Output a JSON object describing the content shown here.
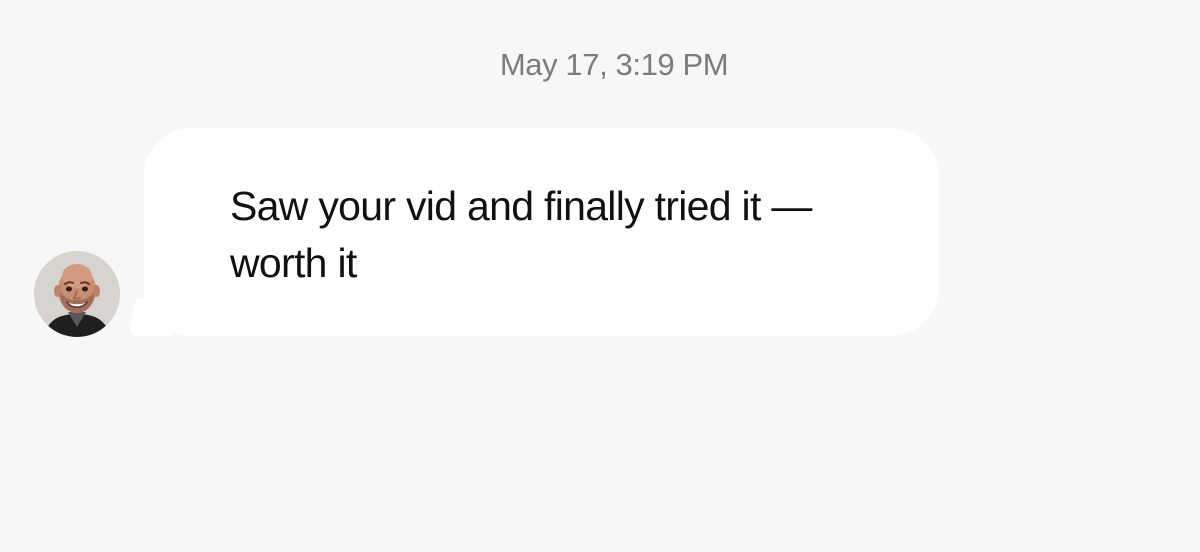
{
  "conversation": {
    "timestamp": "May 17, 3:19 PM",
    "message": {
      "text": "Saw your vid and finally tried it — worth it",
      "sender_avatar": "smiling-man-avatar"
    }
  },
  "colors": {
    "background": "#f7f7f7",
    "bubble": "#ffffff",
    "timestamp_text": "#7c7c7c",
    "message_text": "#111111"
  }
}
